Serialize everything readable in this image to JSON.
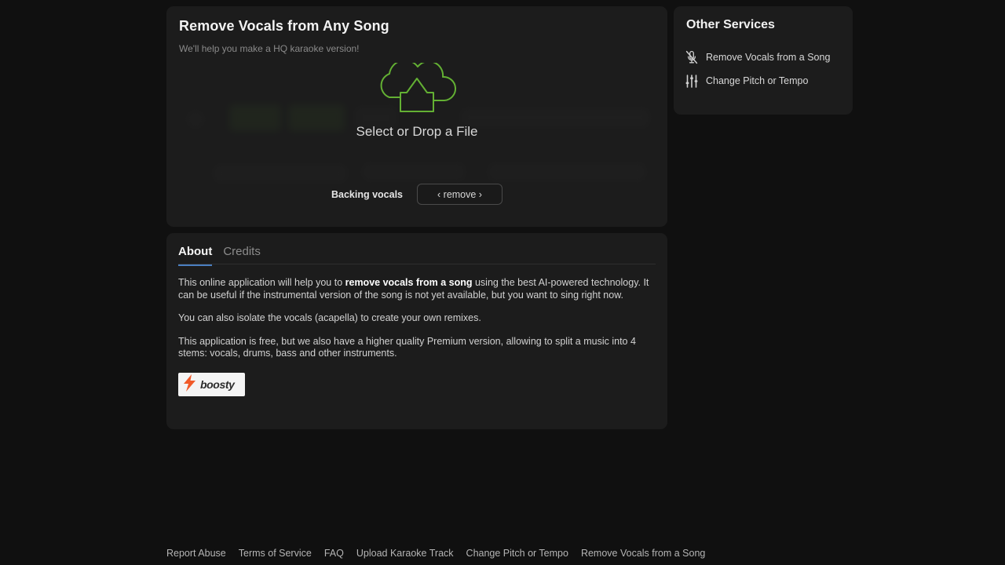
{
  "upload": {
    "title": "Remove Vocals from Any Song",
    "subtitle": "We'll help you make a HQ karaoke version!",
    "dropzone_label": "Select or Drop a File",
    "dropzone_icon": "cloud-upload-icon",
    "backing_vocals_label": "Backing vocals",
    "backing_vocals_value": "‹ remove ›"
  },
  "about": {
    "tabs": [
      {
        "label": "About",
        "active": true
      },
      {
        "label": "Credits",
        "active": false
      }
    ],
    "paragraphs": [
      {
        "lead": "This online application will help you to ",
        "bold": "remove vocals from a song",
        "tail": " using the best AI-powered technology. It can be useful if the instrumental version of the song is not yet available, but you want to sing right now."
      },
      {
        "lead": "You can also isolate the vocals (acapella) to create your own remixes.",
        "bold": "",
        "tail": ""
      },
      {
        "lead": "This application is free, but we also have a higher quality Premium version, allowing to split a music into 4 stems: vocals, drums, bass and other instruments.",
        "bold": "",
        "tail": ""
      }
    ],
    "boosty": {
      "wordmark": "boosty",
      "icon": "boosty-lightning-icon"
    }
  },
  "services": {
    "title": "Other Services",
    "items": [
      {
        "label": "Remove Vocals from a Song",
        "icon": "microphone-muted-icon"
      },
      {
        "label": "Change Pitch or Tempo",
        "icon": "sliders-icon"
      }
    ]
  },
  "footer": {
    "links": [
      "Report Abuse",
      "Terms of Service",
      "FAQ",
      "Upload Karaoke Track",
      "Change Pitch or Tempo",
      "Remove Vocals from a Song"
    ]
  },
  "colors": {
    "page_background": "#101010",
    "card_background": "#1c1c1c",
    "accent_green": "#63b033",
    "accent_blue": "#4a7fc1",
    "boosty_orange": "#f15a29"
  }
}
